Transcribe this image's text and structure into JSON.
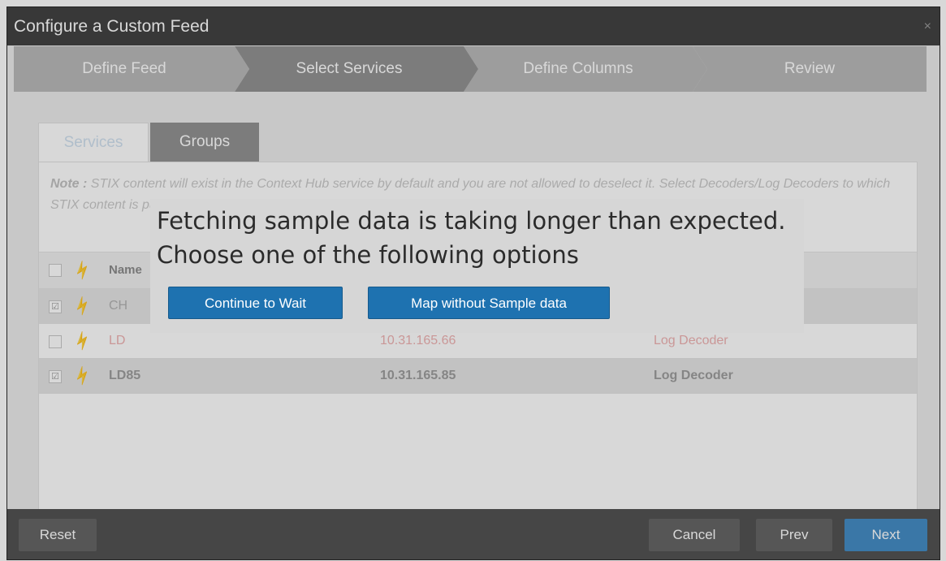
{
  "dialog": {
    "title": "Configure a Custom Feed",
    "close_glyph": "×"
  },
  "wizard": {
    "steps": [
      {
        "label": "Define Feed"
      },
      {
        "label": "Select Services"
      },
      {
        "label": "Define Columns"
      },
      {
        "label": "Review"
      }
    ],
    "active_step": 1
  },
  "tabs": [
    {
      "label": "Services"
    },
    {
      "label": "Groups"
    }
  ],
  "note": {
    "prefix": "Note :",
    "text": "STIX content will exist in the Context Hub service by default and you are not allowed to deselect it. Select Decoders/Log Decoders to which STIX content is pushed. If you do not wish to push STIX content to any Decoders/Log"
  },
  "grid": {
    "name_header": "Name",
    "rows": [
      {
        "name": "CH",
        "address": "",
        "type": "",
        "checked": true,
        "status": "ok"
      },
      {
        "name": "LD",
        "address": "10.31.165.66",
        "type": "Log Decoder",
        "checked": false,
        "status": "error"
      },
      {
        "name": "LD85",
        "address": "10.31.165.85",
        "type": "Log Decoder",
        "checked": true,
        "status": "ok"
      }
    ]
  },
  "footer": {
    "reset_label": "Reset",
    "cancel_label": "Cancel",
    "prev_label": "Prev",
    "next_label": "Next"
  },
  "message": {
    "line1": "Fetching sample data is taking longer than expected.",
    "line2": "Choose one of the following options",
    "continue_label": "Continue to Wait",
    "map_label": "Map without Sample data"
  },
  "colors": {
    "accent_button": "#1e72b0",
    "error_text": "#e8a0a0",
    "ok_plug": "#9ccc6a",
    "error_plug": "#e07070"
  },
  "icons": {
    "checked": "☑",
    "plug": "plug-icon"
  }
}
